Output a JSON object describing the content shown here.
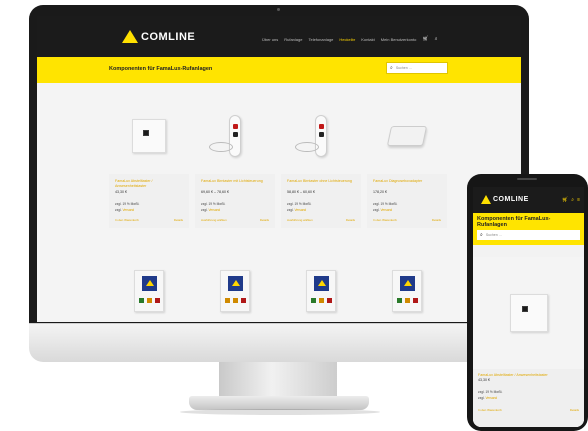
{
  "site": {
    "logo_text": "COMLINE",
    "nav": [
      "Über uns",
      "Rufanlage",
      "Telefonanlage",
      "Heckelbr",
      "Kontakt",
      "Mein Benutzerkonto"
    ],
    "nav_active_index": 3,
    "page_title": "Komponenten für FamaLux-Rufanlagen",
    "search_placeholder": "Suchen …",
    "colors": {
      "accent": "#ffe400",
      "header": "#1b1b1b",
      "link": "#e0a800"
    }
  },
  "products": [
    {
      "name": "FamaLux Abstelltaster / Anwesenheitstaster",
      "price": "43,30 €",
      "vat": "zzgl. 19 % MwSt.",
      "ship_label": "zzgl.",
      "ship_link": "Versand",
      "add": "In den Warenkorb",
      "details": "Details",
      "image": "wall-button-panel"
    },
    {
      "name": "FamaLux Birntaster mit Lichtsteuerung",
      "price": "69,60 € – 78,60 €",
      "vat": "zzgl. 19 % MwSt.",
      "ship_label": "zzgl.",
      "ship_link": "Versand",
      "add": "Ausführung wählen",
      "details": "Details",
      "image": "pendant-call-button"
    },
    {
      "name": "FamaLux Birntaster ohne Lichtsteuerung",
      "price": "58,80 € – 60,60 €",
      "vat": "zzgl. 19 % MwSt.",
      "ship_label": "zzgl.",
      "ship_link": "Versand",
      "add": "Ausführung wählen",
      "details": "Details",
      "image": "pendant-call-button"
    },
    {
      "name": "FamaLux Diagnoseboxadapter",
      "price": "178,20 €",
      "vat": "zzgl. 19 % MwSt.",
      "ship_label": "zzgl.",
      "ship_link": "Versand",
      "add": "In den Warenkorb",
      "details": "Details",
      "image": "adapter-box"
    }
  ],
  "phone": {
    "logo_text": "COMLINE",
    "icons": [
      "cart-icon",
      "search-icon",
      "menu-icon"
    ],
    "page_title": "Komponenten für FamaLux-Rufanlagen",
    "search_placeholder": "Suchen …",
    "product": {
      "name": "FamaLux Abstelltaster / Anwesenheitstaster",
      "price": "43,30 €",
      "vat": "zzgl. 19 % MwSt.",
      "ship_label": "zzgl.",
      "ship_link": "Versand",
      "add": "In den Warenkorb",
      "details": "Details"
    }
  }
}
